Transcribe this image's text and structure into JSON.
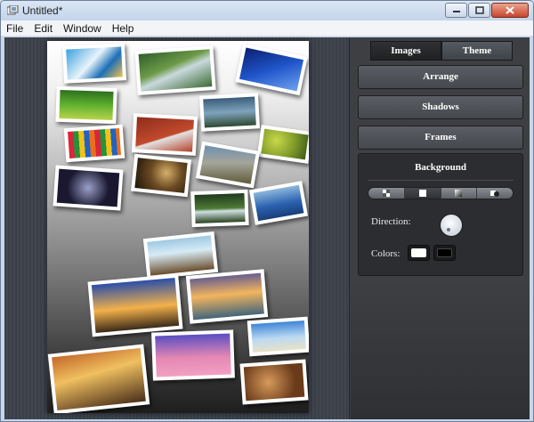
{
  "window": {
    "title": "Untitled*",
    "menu": [
      "File",
      "Edit",
      "Window",
      "Help"
    ]
  },
  "panel": {
    "tabs": [
      {
        "label": "Images",
        "active": false
      },
      {
        "label": "Theme",
        "active": true
      }
    ],
    "buttons": {
      "arrange": "Arrange",
      "shadows": "Shadows",
      "frames": "Frames"
    },
    "background": {
      "title": "Background",
      "modes": [
        "checker-icon",
        "square-icon",
        "gradient-icon",
        "image-icon"
      ],
      "active_mode": 1,
      "direction_label": "Direction:",
      "colors_label": "Colors:",
      "colors": [
        "#ffffff",
        "#000000"
      ]
    }
  },
  "colors": {
    "panel_bg": "#3d3f43",
    "canvas_bg": "#3b3f46",
    "accent": "#ffffff"
  }
}
